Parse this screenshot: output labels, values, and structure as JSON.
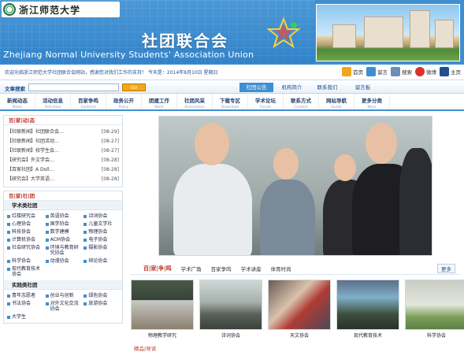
{
  "header": {
    "logo_text": "浙江师范大学",
    "union_title": "社团联合会",
    "union_en": "Zhejiang Normal University Students' Association Union"
  },
  "infobar": {
    "welcome": "欢迎光临浙江师范大学社团联合会网站，感谢您对我们工作的支持！ 今天是：2014年8月10日 星期日",
    "links": [
      {
        "label": "首页",
        "icon": "home-icon",
        "color": "#f0a61e"
      },
      {
        "label": "留言",
        "icon": "message-icon",
        "color": "#3f8fd0"
      },
      {
        "label": "搜索",
        "icon": "search-icon",
        "color": "#6b8fb5"
      },
      {
        "label": "微博",
        "icon": "weibo-icon",
        "color": "#d9342b"
      },
      {
        "label": "主页",
        "icon": "portal-icon",
        "color": "#1f4f8f"
      }
    ]
  },
  "search": {
    "label": "文章搜索",
    "button": "Go"
  },
  "section_tabs": [
    "社团公告",
    "机构简介",
    "联系我们",
    "留言板"
  ],
  "nav": [
    {
      "zh": "新闻动态",
      "en": "News"
    },
    {
      "zh": "活动信息",
      "en": "Activities"
    },
    {
      "zh": "百家争鸣",
      "en": "Contend"
    },
    {
      "zh": "政务公开",
      "en": "Policy"
    },
    {
      "zh": "团建工作",
      "en": "Work"
    },
    {
      "zh": "社团风采",
      "en": "Association"
    },
    {
      "zh": "下载专区",
      "en": "Download"
    },
    {
      "zh": "学术论坛",
      "en": "Forum"
    },
    {
      "zh": "联系方式",
      "en": "Contact"
    },
    {
      "zh": "网站导航",
      "en": "Guide"
    },
    {
      "zh": "更多分类",
      "en": "More"
    }
  ],
  "news_panel": {
    "title": "百|家|动|态",
    "items": [
      {
        "title": "【社联新闻】社团联合会…",
        "date": "[08-29]"
      },
      {
        "title": "【社联新闻】社团活动…",
        "date": "[08-27]"
      },
      {
        "title": "【社联新闻】校学生会…",
        "date": "[08-27]"
      },
      {
        "title": "【研究会】外文学会…",
        "date": "[08-28]"
      },
      {
        "title": "【百家社团】A Doll…",
        "date": "[08-28]"
      },
      {
        "title": "【研究会】大学英语…",
        "date": "[08-28]"
      }
    ]
  },
  "assoc_panel": {
    "title": "百|家|社|团",
    "group1": {
      "title": "学术类社团",
      "items": [
        "红楼研究会",
        "英语协会",
        "诗词协会",
        "心理协会",
        "国学协会",
        "儿童文学社",
        "科技协会",
        "数学建模",
        "物理协会",
        "计算机协会",
        "ACM协会",
        "电子协会",
        "社会研究协会",
        "环境与教育研究协会",
        "摄影协会",
        "科学协会",
        "动漫协会",
        "辩论协会",
        "现代教育技术协会"
      ]
    },
    "group2": {
      "title": "实践类社团",
      "items": [
        "青年志愿者",
        "创业与创新",
        "绿色协会",
        "书法协会",
        "对外文化交流协会",
        "旅游协会",
        "大学生"
      ]
    }
  },
  "gallery": {
    "title": "百|家|争|鸣",
    "tabs": [
      "学术广角",
      "百家争鸣",
      "学术讲座",
      "体育时尚"
    ],
    "more": "更多",
    "items": [
      {
        "caption": "物理教学研究"
      },
      {
        "caption": "诗词协会"
      },
      {
        "caption": "天文协会"
      },
      {
        "caption": "现代教育技术"
      },
      {
        "caption": "科学协会"
      }
    ]
  },
  "notice": "精品|导读"
}
